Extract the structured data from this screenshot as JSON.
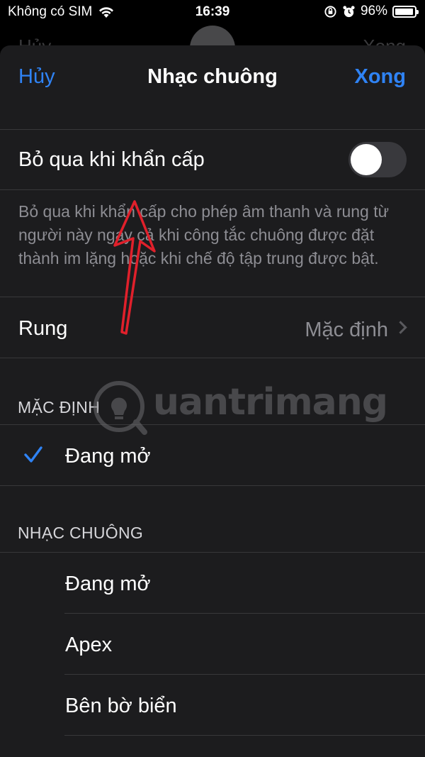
{
  "status_bar": {
    "carrier": "Không có SIM",
    "time": "16:39",
    "battery": "96%",
    "battery_level": 0.96
  },
  "background_sheet": {
    "left": "Hủy",
    "right": "Xong"
  },
  "nav": {
    "cancel_label": "Hủy",
    "title": "Nhạc chuông",
    "done_label": "Xong"
  },
  "emergency_bypass": {
    "label": "Bỏ qua khi khẩn cấp",
    "enabled": false,
    "footnote": "Bỏ qua khi khẩn cấp cho phép âm thanh và rung từ người này ngay cả khi công tắc chuông được đặt thành im lặng hoặc khi chế độ tập trung được bật."
  },
  "vibration": {
    "label": "Rung",
    "value": "Mặc định"
  },
  "default_section": {
    "header": "MẶC ĐỊNH",
    "items": [
      {
        "label": "Đang mở",
        "selected": true
      }
    ]
  },
  "ringtone_section": {
    "header": "NHẠC CHUÔNG",
    "items": [
      {
        "label": "Đang mở"
      },
      {
        "label": "Apex"
      },
      {
        "label": "Bên bờ biển"
      }
    ]
  },
  "watermark": {
    "text": "uantrimang"
  },
  "colors": {
    "accent": "#2f83f5",
    "sheet_bg": "#1c1c1e",
    "annotation_arrow": "#e0202b"
  }
}
